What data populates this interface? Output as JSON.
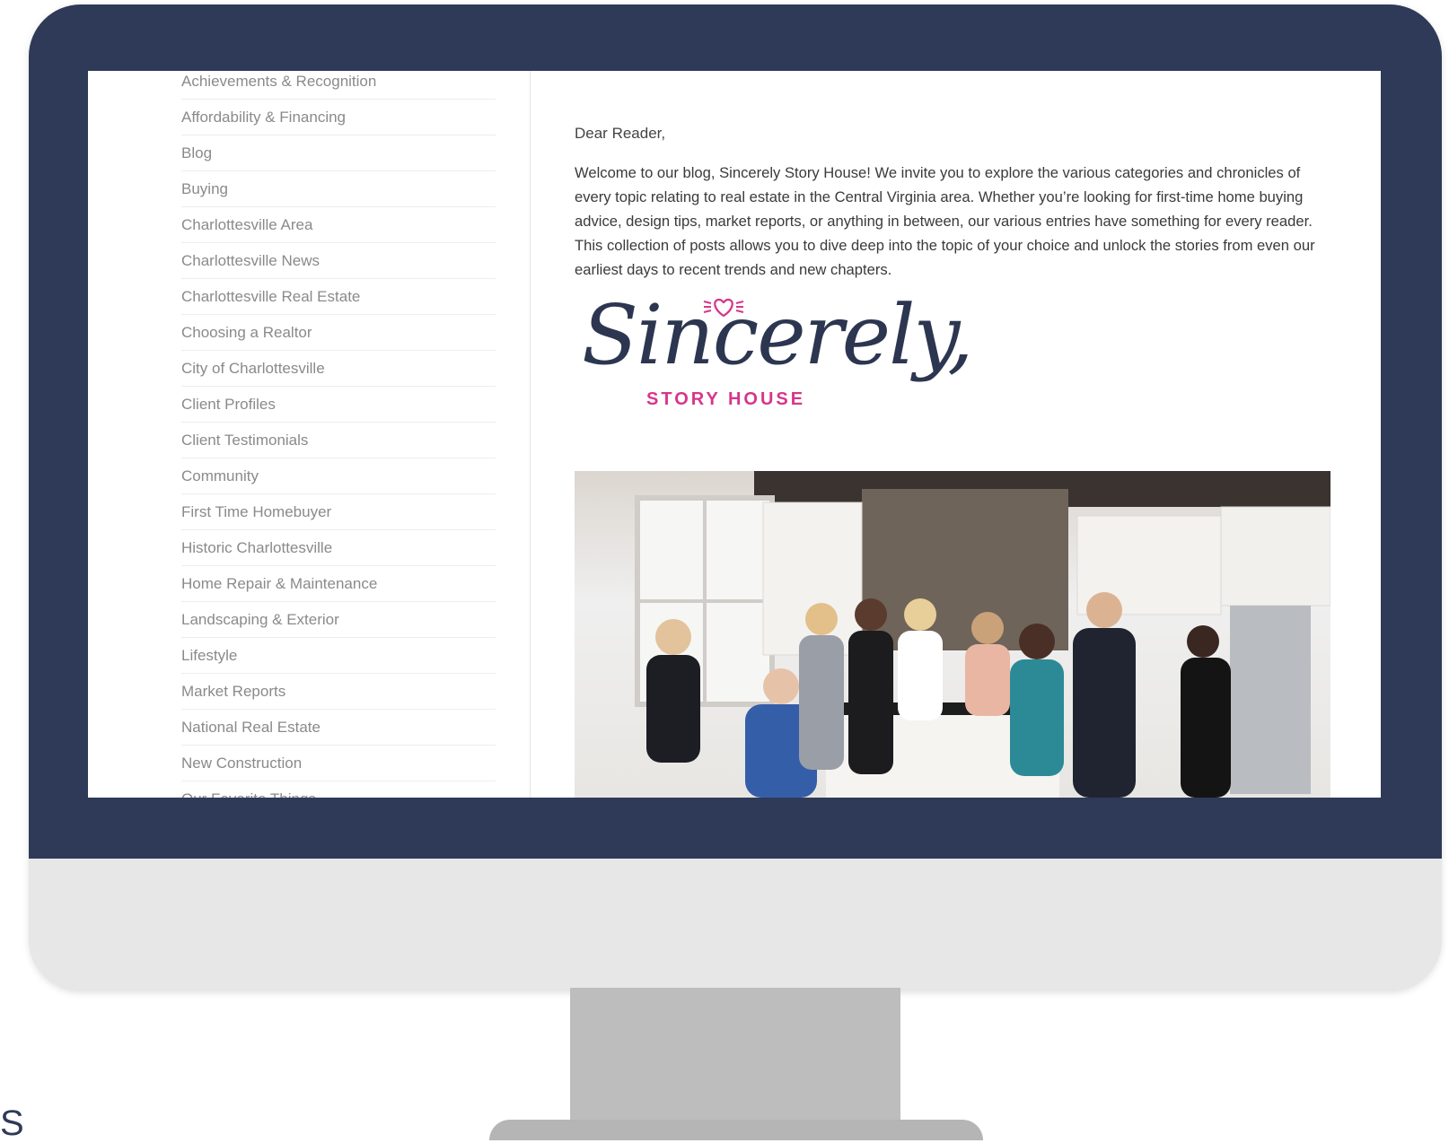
{
  "sidebar": {
    "categories": [
      "Achievements & Recognition",
      "Affordability & Financing",
      "Blog",
      "Buying",
      "Charlottesville Area",
      "Charlottesville News",
      "Charlottesville Real Estate",
      "Choosing a Realtor",
      "City of Charlottesville",
      "Client Profiles",
      "Client Testimonials",
      "Community",
      "First Time Homebuyer",
      "Historic Charlottesville",
      "Home Repair & Maintenance",
      "Landscaping & Exterior",
      "Lifestyle",
      "Market Reports",
      "National Real Estate",
      "New Construction",
      "Our Favorite Things"
    ]
  },
  "content": {
    "greeting": "Dear Reader,",
    "intro": "Welcome to our blog, Sincerely Story House! We invite you to explore the various categories and chronicles of every topic relating to real estate in the Central Virginia area. Whether you’re looking for first-time home buying advice, design tips, market reports, or anything in between, our various entries have something for every reader. This collection of posts allows you to dive deep into the topic of your choice and unlock the stories from even our earliest days to recent trends and new chapters.",
    "signature_script": "Sincerely,",
    "signature_sub": "STORY HOUSE"
  },
  "colors": {
    "bezel": "#2f3a58",
    "chin": "#e7e7e7",
    "stand": "#bdbdbd",
    "accent_pink": "#d6368a",
    "sidebar_text": "#8a8a8a"
  },
  "stray_text": "S"
}
